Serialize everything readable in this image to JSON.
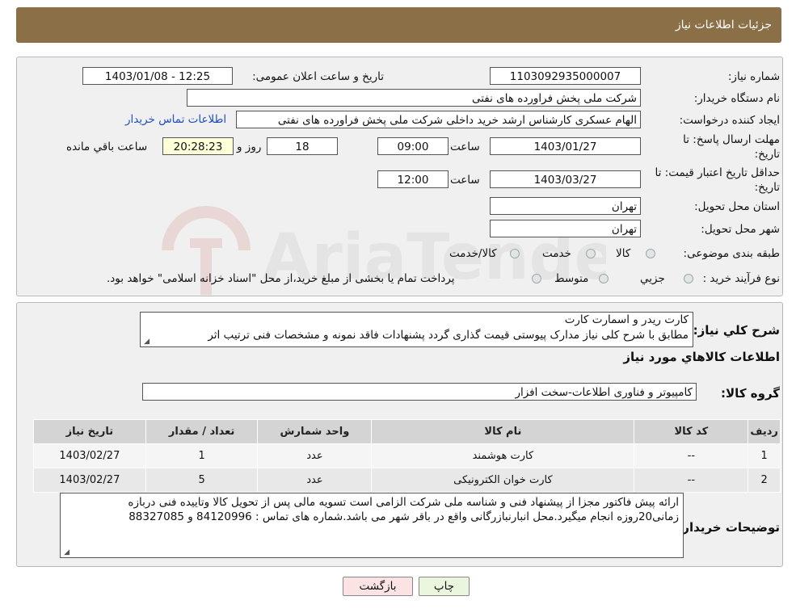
{
  "header": {
    "title": "جزئیات اطلاعات نیاز"
  },
  "form": {
    "need_number_label": "شماره نیاز:",
    "need_number": "1103092935000007",
    "announce_label": "تاریخ و ساعت اعلان عمومی:",
    "announce_value": "1403/01/08 - 12:25",
    "buyer_org_label": "نام دستگاه خریدار:",
    "buyer_org": "شرکت ملی پخش فراورده های نفتی",
    "creator_label": "ایجاد کننده درخواست:",
    "creator": "الهام عسکری کارشناس ارشد خرید داخلی شرکت ملی پخش فراورده های نفتی",
    "contact_link": "اطلاعات تماس خریدار",
    "deadline_label_1": "مهلت ارسال پاسخ: تا",
    "deadline_label_2": "تاریخ:",
    "deadline_date": "1403/01/27",
    "time_label": "ساعت",
    "deadline_time": "09:00",
    "days_value": "18",
    "days_label": "روز و",
    "remaining_time": "20:28:23",
    "remaining_label": "ساعت باقي مانده",
    "validity_label_1": "حداقل تاریخ اعتبار قیمت: تا",
    "validity_label_2": "تاریخ:",
    "validity_date": "1403/03/27",
    "validity_time": "12:00",
    "province_label": "استان محل تحویل:",
    "province": "تهران",
    "city_label": "شهر محل تحویل:",
    "city": "تهران",
    "category_label": "طبقه بندی موضوعی:",
    "category_options": [
      "کالا",
      "خدمت",
      "کالا/خدمت"
    ],
    "process_label": "نوع فرآیند خرید :",
    "process_options": [
      "جزیي",
      "متوسط"
    ],
    "process_note": "پرداخت تمام یا بخشی از مبلغ خرید،از محل \"اسناد خزانه اسلامی\" خواهد بود."
  },
  "details": {
    "summary_label": "شرح كلي نياز:",
    "summary_line1": "کارت ریدر و اسمارت کارت",
    "summary_line2": "مطابق با شرح کلی نیاز مدارک پیوستی قیمت گذاری گردد پشنهادات فاقد نمونه و مشخصات فنی ترتیب اثر",
    "goods_info_title": "اطلاعات كالاهاي مورد نياز",
    "goods_group_label": "گروه کالا:",
    "goods_group": "کامپیوتر و فناوری اطلاعات-سخت افزار",
    "table": {
      "headers": [
        "رديف",
        "کد کالا",
        "نام کالا",
        "واحد شمارش",
        "تعداد / مقدار",
        "تاریخ نیاز"
      ],
      "rows": [
        [
          "1",
          "--",
          "کارت هوشمند",
          "عدد",
          "1",
          "1403/02/27"
        ],
        [
          "2",
          "--",
          "کارت خوان الکترونیکی",
          "عدد",
          "5",
          "1403/02/27"
        ]
      ]
    },
    "buyer_notes_label": "توضیحات خریدار:",
    "buyer_notes_line1": "ارائه پیش فاکتور مجزا از پیشنهاد فنی و شناسه ملی شرکت الزامی است تسویه مالی پس از تحویل کالا وتاییده فنی دربازه",
    "buyer_notes_line2": "زمانی20روزه انجام میگیرد.محل انبارنبازرگانی واقع در باقر شهر می باشد.شماره های تماس : 84120996 و 88327085"
  },
  "buttons": {
    "print": "چاپ",
    "back": "بازگشت"
  },
  "watermark": {
    "text": "AriaTender.neT"
  },
  "colors": {
    "header_bg": "#8b6f47",
    "link": "#1f4fbf",
    "print_btn": "#eaf6dd",
    "back_btn": "#fbe3e3"
  }
}
